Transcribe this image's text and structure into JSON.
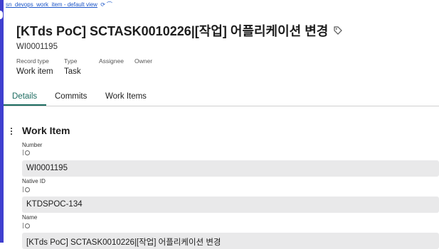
{
  "breadcrumb": {
    "link": "sn_devops_work_item - default view"
  },
  "header": {
    "title": "[KTds PoC] SCTASK0010226|[작업] 어플리케이션 변경",
    "number": "WI0001195"
  },
  "meta": {
    "record_type_label": "Record type",
    "type_label": "Type",
    "assignee_label": "Assignee",
    "owner_label": "Owner",
    "record_type_value": "Work item",
    "type_value": "Task"
  },
  "tabs": [
    "Details",
    "Commits",
    "Work Items"
  ],
  "section": {
    "title": "Work Item"
  },
  "fields": [
    {
      "label": "Number",
      "value": "WI0001195"
    },
    {
      "label": "Native ID",
      "value": "KTDSPOC-134"
    },
    {
      "label": "Name",
      "value": "[KTds PoC] SCTASK0010226|[작업] 어플리케이션 변경"
    }
  ],
  "colors": {
    "accent": "#1d6c61",
    "rail": "#3f3fcf",
    "link": "#1a55c8",
    "field_bg": "#e9e9ea"
  }
}
